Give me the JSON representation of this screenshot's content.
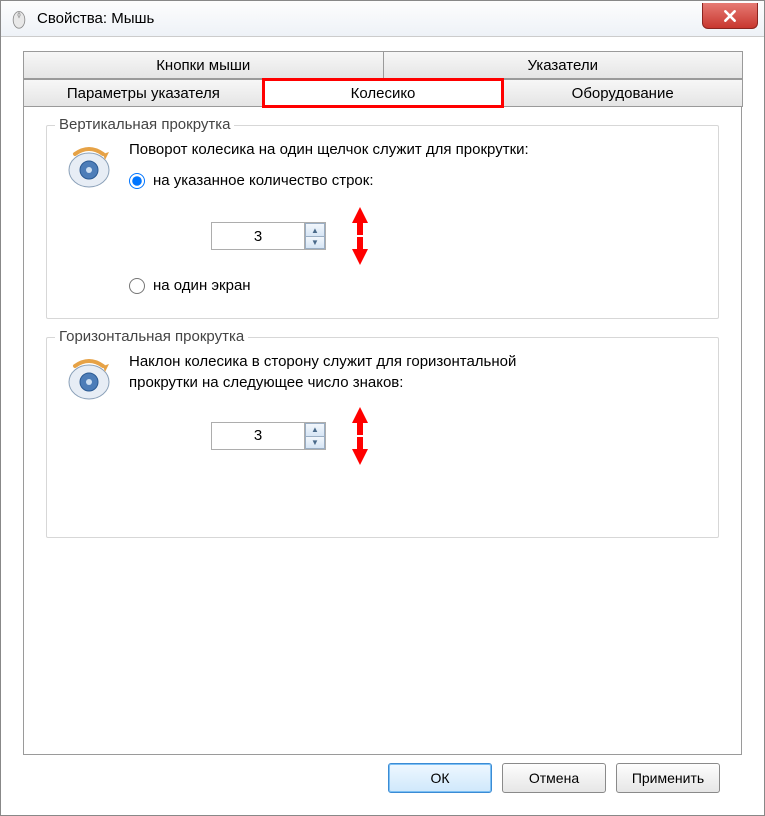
{
  "titlebar": {
    "text": "Свойства: Мышь"
  },
  "tabs": {
    "top": [
      {
        "label": "Кнопки мыши"
      },
      {
        "label": "Указатели"
      }
    ],
    "bottom": [
      {
        "label": "Параметры указателя"
      },
      {
        "label": "Колесико",
        "active": true,
        "highlight": true
      },
      {
        "label": "Оборудование"
      }
    ]
  },
  "vertical": {
    "title": "Вертикальная прокрутка",
    "desc": "Поворот колесика на один щелчок служит для прокрутки:",
    "opt1": "на указанное количество строк:",
    "value": "3",
    "opt2": "на один экран"
  },
  "horizontal": {
    "title": "Горизонтальная прокрутка",
    "desc": "Наклон колесика в сторону служит для горизонтальной прокрутки на следующее число знаков:",
    "value": "3"
  },
  "buttons": {
    "ok": "ОК",
    "cancel": "Отмена",
    "apply": "Применить"
  }
}
